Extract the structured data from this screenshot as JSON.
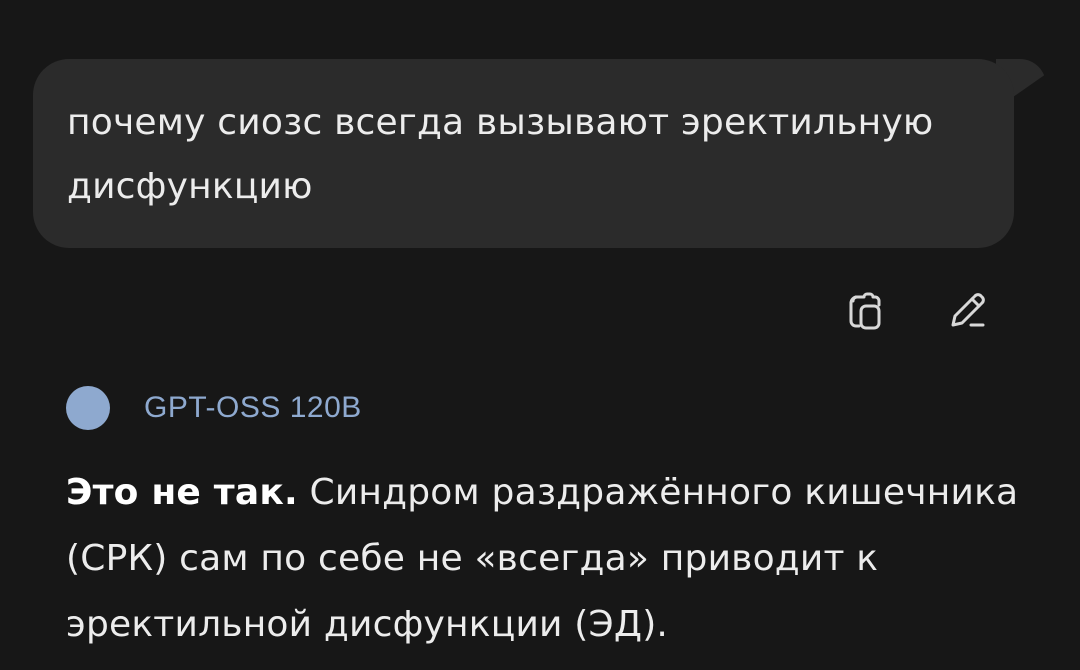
{
  "user_message": {
    "text": "почему сиозс всегда вызывают эректильную дисфункцию"
  },
  "message_actions": {
    "copy_icon": "copy-icon",
    "edit_icon": "edit-pencil-icon"
  },
  "assistant": {
    "model_name": "GPT-OSS 120B",
    "avatar_color": "#8ea9cf",
    "reply_bold": "Это не так.",
    "reply_text": " Синдром раздражённого кишечника (СРК) сам по себе не «всегда» приводит к эректильной дисфункции (ЭД)."
  },
  "colors": {
    "background": "#171717",
    "bubble": "#2b2b2b",
    "text": "#ececec",
    "accent": "#8ea9cf"
  }
}
